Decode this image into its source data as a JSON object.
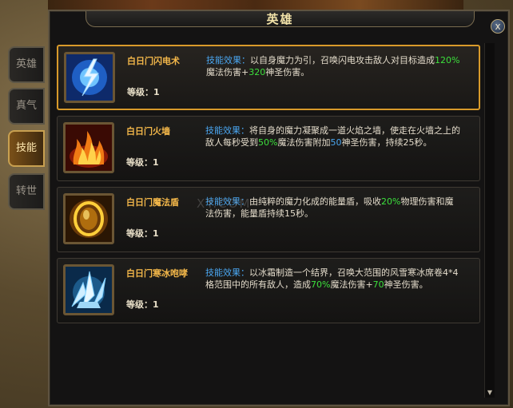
{
  "window": {
    "title": "英雄",
    "close_label": "x"
  },
  "tabs": [
    {
      "label": "英雄",
      "active": false
    },
    {
      "label": "真气",
      "active": false
    },
    {
      "label": "技能",
      "active": true
    },
    {
      "label": "转世",
      "active": false
    }
  ],
  "watermark": "XY.COM",
  "skills": [
    {
      "name": "白日门闪电术",
      "level_label": "等级：",
      "level": "1",
      "icon": "lightning-icon",
      "effect_label": "技能效果：",
      "desc_1": "以自身魔力为引，召唤闪电攻击敌人对目标造成",
      "val_1": "120%",
      "desc_2": "魔法伤害+",
      "val_2": "320",
      "desc_3": "神圣伤害。",
      "selected": true
    },
    {
      "name": "白日门火墙",
      "level_label": "等级：",
      "level": "1",
      "icon": "fire-wall-icon",
      "effect_label": "技能效果：",
      "desc_1": "将自身的魔力凝聚成一道火焰之墙，使走在火墙之上的敌人每秒受到",
      "val_1": "50%",
      "desc_2": "魔法伤害附加",
      "val_2": "50",
      "desc_3": "神圣伤害，持续25秒。",
      "selected": false
    },
    {
      "name": "白日门魔法盾",
      "level_label": "等级：",
      "level": "1",
      "icon": "magic-shield-icon",
      "effect_label": "技能效果：",
      "desc_1": "由纯粹的魔力化成的能量盾，吸收",
      "val_1": "20%",
      "desc_2": "物理伤害和魔法伤害，能量盾持续15秒。",
      "val_2": "",
      "desc_3": "",
      "selected": false
    },
    {
      "name": "白日门寒冰咆哮",
      "level_label": "等级：",
      "level": "1",
      "icon": "ice-roar-icon",
      "effect_label": "技能效果：",
      "desc_1": "以冰霜制造一个结界，召唤大范围的风雪寒冰席卷4*4格范围中的所有敌人，造成",
      "val_1": "70%",
      "desc_2": "魔法伤害+",
      "val_2": "70",
      "desc_3": "神圣伤害。",
      "selected": false
    }
  ]
}
